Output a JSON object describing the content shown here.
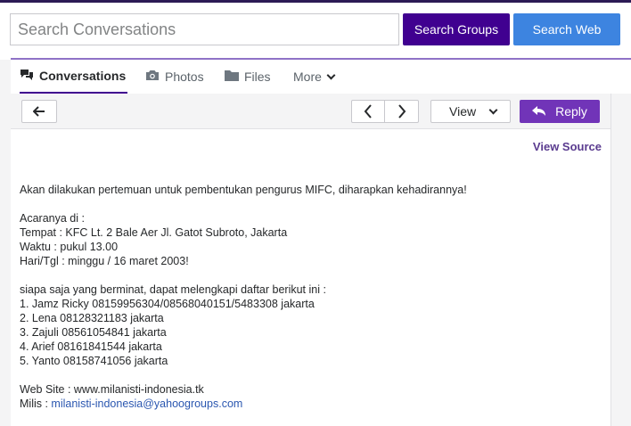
{
  "search": {
    "placeholder": "Search Conversations",
    "groups_label": "Search Groups",
    "web_label": "Search Web"
  },
  "tabs": [
    {
      "label": "Conversations",
      "icon": "conversations-icon",
      "active": true
    },
    {
      "label": "Photos",
      "icon": "camera-icon"
    },
    {
      "label": "Files",
      "icon": "folder-icon"
    },
    {
      "label": "More",
      "icon": "chevron-down-icon"
    }
  ],
  "toolbar": {
    "view_label": "View",
    "reply_label": "Reply"
  },
  "view_source_label": "View Source",
  "message": {
    "intro": "Akan dilakukan pertemuan untuk pembentukan pengurus MIFC, diharapkan kehadirannya!",
    "event_lines": [
      "Acaranya di :",
      "Tempat : KFC Lt. 2 Bale Aer Jl. Gatot Subroto, Jakarta",
      "Waktu : pukul 13.00",
      "Hari/Tgl : minggu / 16 maret 2003!"
    ],
    "list_intro": "siapa saja yang berminat, dapat melengkapi daftar berikut ini :",
    "list_items": [
      "1. Jamz Ricky 08159956304/08568040151/5483308 jakarta",
      "2. Lena 08128321183 jakarta",
      "3. Zajuli 08561054841 jakarta",
      "4. Arief 08161841544 jakarta",
      "5. Yanto 08158741056 jakarta"
    ],
    "website": "Web Site : www.milanisti-indonesia.tk",
    "milis_prefix": "Milis : ",
    "milis_link": "milanisti-indonesia@yahoogroups.com"
  },
  "colors": {
    "groups_button": "#400090",
    "web_button": "#3d84e0",
    "reply_button": "#7134b8",
    "link": "#2b57b0"
  }
}
